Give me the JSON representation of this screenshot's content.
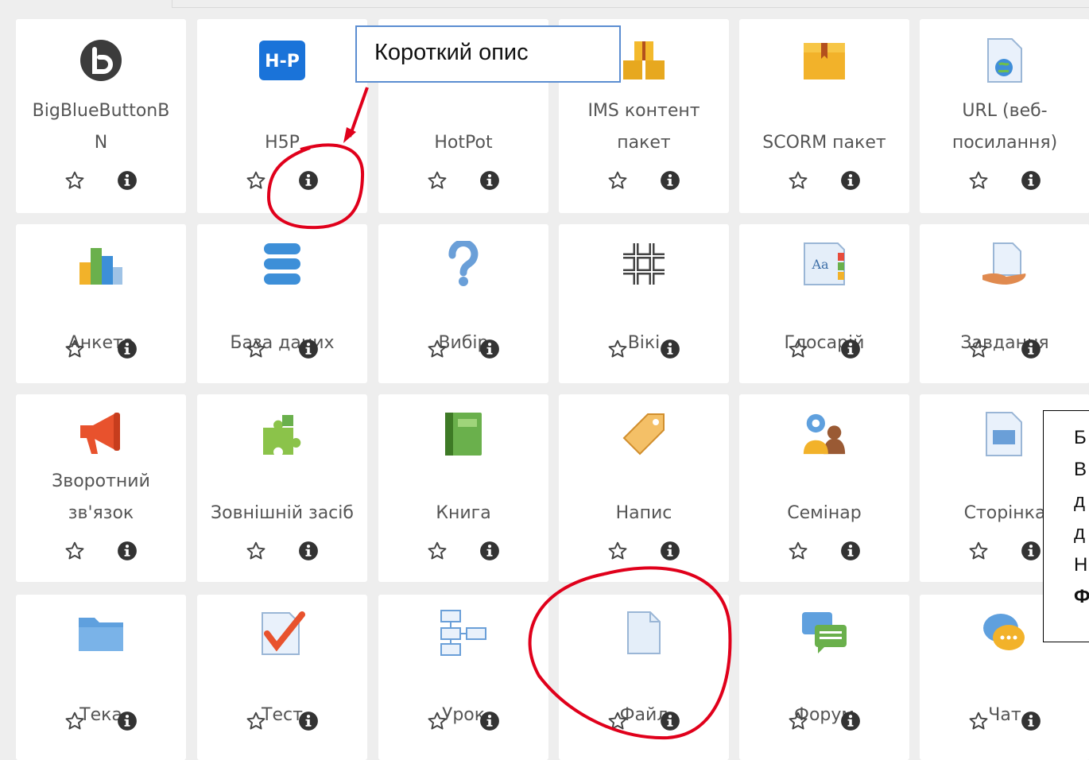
{
  "callout": {
    "text": "Короткий опис"
  },
  "side_note": {
    "lines": [
      "Б",
      "В",
      "д",
      "д",
      "Н",
      "Ф"
    ]
  },
  "colors": {
    "annotation_red": "#e0001b",
    "callout_border": "#5b8dd1",
    "label_text": "#555555"
  },
  "activities": [
    {
      "label_lines": [
        "BigBlueButtonB",
        "N"
      ],
      "icon": "bigbluebutton-icon"
    },
    {
      "label_lines": [
        "H5P"
      ],
      "icon": "h5p-icon"
    },
    {
      "label_lines": [
        "HotPot"
      ],
      "icon": "hotpot-icon"
    },
    {
      "label_lines": [
        "IMS контент",
        "пакет"
      ],
      "icon": "ims-package-icon"
    },
    {
      "label_lines": [
        "SCORM пакет"
      ],
      "icon": "scorm-package-icon"
    },
    {
      "label_lines": [
        "URL (веб-",
        "посилання)"
      ],
      "icon": "url-icon"
    },
    {
      "label_lines": [
        "Анкета"
      ],
      "icon": "survey-chart-icon"
    },
    {
      "label_lines": [
        "База даних"
      ],
      "icon": "database-icon"
    },
    {
      "label_lines": [
        "Вибір"
      ],
      "icon": "question-mark-icon"
    },
    {
      "label_lines": [
        "Вікі"
      ],
      "icon": "wiki-icon"
    },
    {
      "label_lines": [
        "Глосарій"
      ],
      "icon": "glossary-icon"
    },
    {
      "label_lines": [
        "Завдання"
      ],
      "icon": "assignment-icon"
    },
    {
      "label_lines": [
        "Зворотний",
        "зв'язок"
      ],
      "icon": "megaphone-icon"
    },
    {
      "label_lines": [
        "Зовнішній засіб"
      ],
      "icon": "puzzle-icon"
    },
    {
      "label_lines": [
        "Книга"
      ],
      "icon": "book-icon"
    },
    {
      "label_lines": [
        "Напис"
      ],
      "icon": "label-tag-icon"
    },
    {
      "label_lines": [
        "Семінар"
      ],
      "icon": "workshop-icon"
    },
    {
      "label_lines": [
        "Сторінка"
      ],
      "icon": "page-icon"
    },
    {
      "label_lines": [
        "Тека"
      ],
      "icon": "folder-icon"
    },
    {
      "label_lines": [
        "Тест"
      ],
      "icon": "quiz-icon"
    },
    {
      "label_lines": [
        "Урок"
      ],
      "icon": "lesson-icon"
    },
    {
      "label_lines": [
        "Файл"
      ],
      "icon": "file-icon"
    },
    {
      "label_lines": [
        "Форум"
      ],
      "icon": "forum-icon"
    },
    {
      "label_lines": [
        "Чат"
      ],
      "icon": "chat-icon"
    }
  ]
}
